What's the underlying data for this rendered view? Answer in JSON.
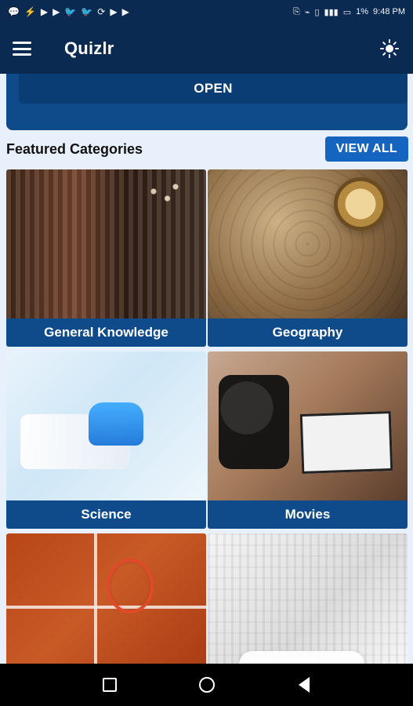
{
  "status_bar": {
    "left_icons": [
      "chat-icon",
      "messenger-icon",
      "video-icon",
      "video-icon",
      "twitter-icon",
      "twitter-icon",
      "sync-icon",
      "youtube-icon",
      "youtube-icon"
    ],
    "right": {
      "battery_percent": "1%",
      "time": "9:48 PM"
    }
  },
  "app_bar": {
    "title": "Quizlr"
  },
  "hero": {
    "open_label": "OPEN"
  },
  "featured": {
    "title": "Featured Categories",
    "view_all_label": "VIEW ALL",
    "categories": [
      {
        "label": "General Knowledge"
      },
      {
        "label": "Geography"
      },
      {
        "label": "Science"
      },
      {
        "label": "Movies"
      },
      {
        "label": ""
      },
      {
        "label": ""
      }
    ]
  }
}
